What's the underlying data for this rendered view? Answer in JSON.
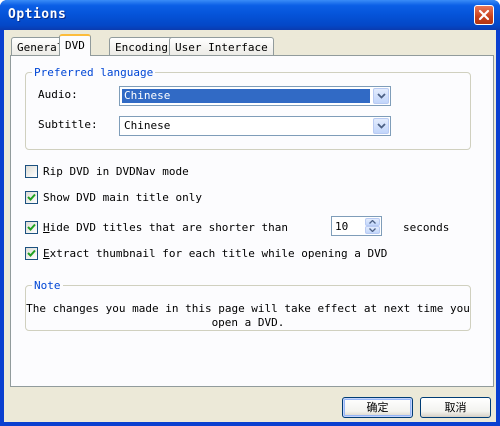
{
  "window": {
    "title": "Options"
  },
  "tabs": [
    {
      "label": "General"
    },
    {
      "label": "DVD"
    },
    {
      "label": "Encoding"
    },
    {
      "label": "User Interface"
    }
  ],
  "active_tab": "DVD",
  "preferred_language": {
    "legend": "Preferred language",
    "audio_label": "Audio:",
    "audio_value": "Chinese",
    "subtitle_label": "Subtitle:",
    "subtitle_value": "Chinese"
  },
  "options": {
    "rip_dvdnav": {
      "label": "Rip DVD in DVDNav mode",
      "checked": false
    },
    "main_title_only": {
      "label": "Show DVD main title only",
      "checked": true
    },
    "hide_short_prefix": "H",
    "hide_short_rest": "ide DVD titles that are shorter than",
    "hide_short_checked": true,
    "hide_short_seconds": "10",
    "seconds_label": "seconds",
    "extract_prefix": "E",
    "extract_rest": "xtract thumbnail for each title while opening a DVD",
    "extract_checked": true
  },
  "note": {
    "legend": "Note",
    "line1": "The changes you made in this page will take effect at next time you",
    "line2": "open a DVD."
  },
  "buttons": {
    "ok": "确定",
    "cancel": "取消"
  },
  "colors": {
    "title_bar": "#0553d8",
    "accent_legend": "#0046d5",
    "selection": "#316ac5",
    "active_tab_highlight": "#fcbc3c"
  }
}
